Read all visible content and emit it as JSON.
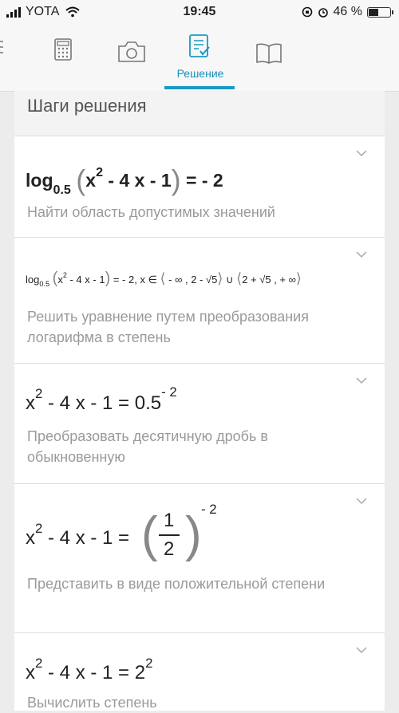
{
  "status_bar": {
    "carrier": "YOTA",
    "time": "19:45",
    "battery": "46 %",
    "battery_level": 0.46
  },
  "toolbar": {
    "active_tab_label": "Решение",
    "accent": "#1a9ac3"
  },
  "steps_title": "Шаги решения",
  "steps": [
    {
      "formula": "log0.5(x2 - 4x - 1) = -2",
      "description": "Найти область допустимых значений"
    },
    {
      "formula": "log0.5(x2 - 4x - 1) = -2 , x ∈ ⟨-∞ , 2-√5⟩ ∪ ⟨2+√5 , +∞⟩",
      "description": "Решить уравнение путем преобразования логарифма в степень"
    },
    {
      "formula": "x2 - 4x - 1 = 0.5-2",
      "description": "Преобразовать десятичную дробь в обыкновенную"
    },
    {
      "formula": "x2 - 4x - 1 = (1/2)-2",
      "description": "Представить в виде положительной степени"
    },
    {
      "formula": "x2 - 4x - 1 = 22",
      "description": "Вычислить степень"
    }
  ],
  "f": {
    "log": "log",
    "b": "0.5",
    "lp": "(",
    "rp": ")",
    "x": "x",
    "two": "2",
    "m4x1": " - 4 x - 1",
    "eqm2": " = - 2",
    "dom": ", x ∈ ",
    "l1": "⟨",
    "r1": "⟩",
    "a1": " - ∞ , 2 - ",
    "sq5": "√5",
    "cup": " ∪ ",
    "a2": "2 + ",
    "a3": " , + ∞",
    "eq": " = ",
    "half": "0.5",
    "m2": "- 2",
    "one": "1"
  }
}
